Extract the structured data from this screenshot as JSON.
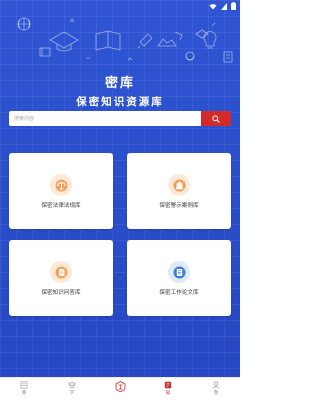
{
  "app": {
    "title": "密库",
    "subtitle": "保密知识资源库"
  },
  "search": {
    "placeholder": "搜索内容"
  },
  "cards": [
    {
      "label": "保密法律法规库",
      "icon": "scale-icon"
    },
    {
      "label": "保密警示案例库",
      "icon": "alarm-icon"
    },
    {
      "label": "保密知识问答库",
      "icon": "qa-document-icon"
    },
    {
      "label": "保密工作论文库",
      "icon": "paper-book-icon"
    }
  ],
  "tabs": [
    {
      "label": "库",
      "icon": "library-icon"
    },
    {
      "label": "学",
      "icon": "study-icon"
    },
    {
      "label": "",
      "icon": "emblem-icon"
    },
    {
      "label": "知",
      "icon": "knowledge-icon"
    },
    {
      "label": "我",
      "icon": "profile-icon"
    }
  ],
  "colors": {
    "primary": "#2f55d4",
    "accent": "#d42a2a",
    "card_bg": "#ffffff",
    "badge_orange": "#f2994a",
    "badge_blue": "#3d7fd8"
  }
}
